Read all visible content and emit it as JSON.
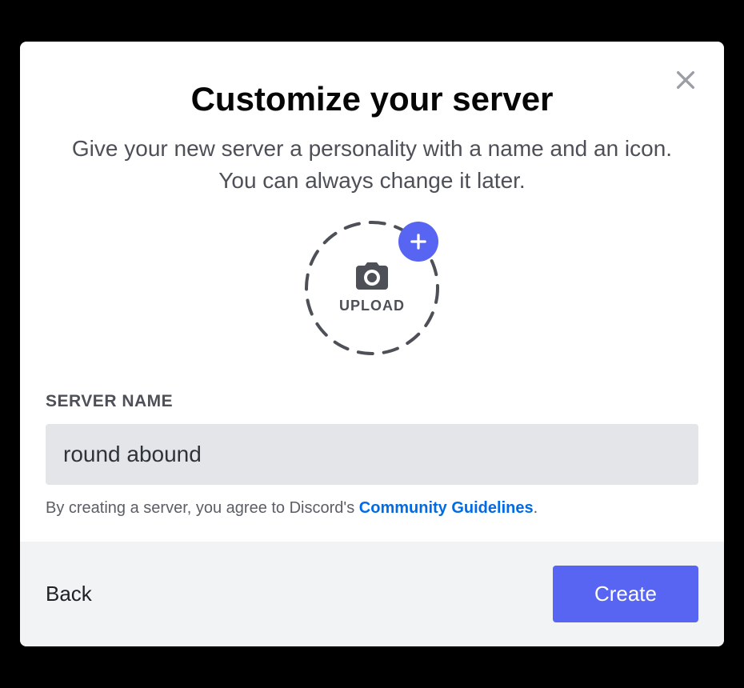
{
  "modal": {
    "title": "Customize your server",
    "subtitle": "Give your new server a personality with a name and an icon. You can always change it later.",
    "upload_label": "UPLOAD",
    "field_label": "SERVER NAME",
    "server_name_value": "round abound",
    "consent_prefix": "By creating a server, you agree to Discord's ",
    "consent_link": "Community Guidelines",
    "consent_suffix": ".",
    "back_label": "Back",
    "create_label": "Create"
  }
}
